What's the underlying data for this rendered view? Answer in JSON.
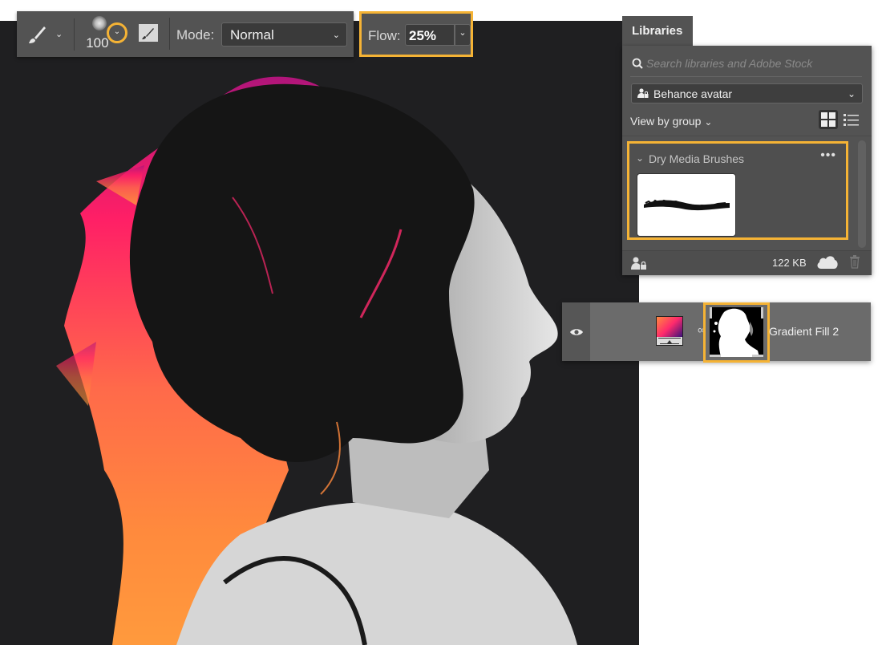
{
  "toolbar": {
    "tool_icon": "brush-icon",
    "brush_size": "100",
    "brush_size_dropdown_icon": "chevron-down-icon",
    "brush_settings_icon": "brush-settings-panel-icon",
    "mode_label": "Mode:",
    "mode_value": "Normal",
    "flow_label": "Flow:",
    "flow_value": "25%"
  },
  "libraries": {
    "tab_label": "Libraries",
    "search_placeholder": "Search libraries and Adobe Stock",
    "library_selected": "Behance avatar",
    "view_by_label": "View by group",
    "group": {
      "title": "Dry Media Brushes",
      "items": [
        {
          "type": "brush",
          "name": "dry-media-brush-stroke"
        }
      ]
    },
    "footer": {
      "size": "122 KB"
    }
  },
  "layer": {
    "name": "Gradient Fill 2",
    "visible": true,
    "type": "gradient-fill"
  },
  "colors": {
    "highlight": "#f5b335",
    "canvas_bg": "#1f1f21",
    "panel_bg": "#535353",
    "gradient_start": "#ff8a3d",
    "gradient_mid": "#ff2a6d",
    "gradient_end": "#3a127a"
  }
}
